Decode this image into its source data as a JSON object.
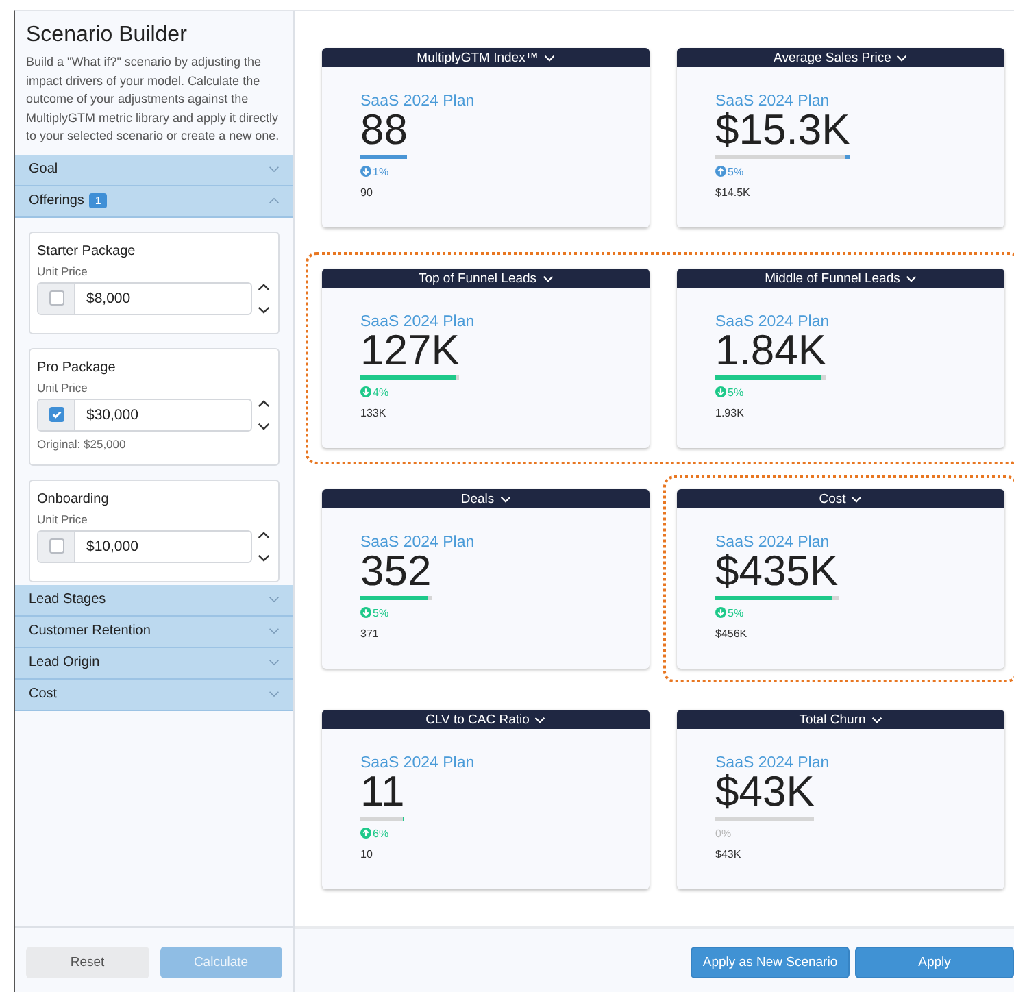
{
  "sidebar": {
    "title": "Scenario Builder",
    "description": "Build a \"What if?\" scenario by adjusting the impact drivers of your model. Calculate the outcome of your adjustments against the MultiplyGTM metric library and apply it directly to your selected scenario or create a new one.",
    "sections": [
      {
        "label": "Goal",
        "expanded": false
      },
      {
        "label": "Offerings",
        "expanded": true,
        "badge": "1",
        "items": [
          {
            "name": "Starter Package",
            "field_label": "Unit Price",
            "checked": false,
            "value": "$8,000"
          },
          {
            "name": "Pro Package",
            "field_label": "Unit Price",
            "checked": true,
            "value": "$30,000",
            "note": "Original: $25,000"
          },
          {
            "name": "Onboarding",
            "field_label": "Unit Price",
            "checked": false,
            "value": "$10,000"
          }
        ]
      },
      {
        "label": "Lead Stages",
        "expanded": false
      },
      {
        "label": "Customer Retention",
        "expanded": false
      },
      {
        "label": "Lead Origin",
        "expanded": false
      },
      {
        "label": "Cost",
        "expanded": false
      }
    ],
    "buttons": [
      {
        "label": "Reset",
        "kind": "secondary",
        "disabled": false
      },
      {
        "label": "Calculate",
        "kind": "primary",
        "disabled": true
      }
    ]
  },
  "metric_rows": [
    {
      "highlighted": false,
      "cards": [
        {
          "title": "MultiplyGTM Index™",
          "plan": "SaaS 2024 Plan",
          "value": "88",
          "level": 1,
          "kind": "down",
          "color": "#4a96d6",
          "delta": "1%",
          "baseline": "90",
          "highlighted": false
        },
        {
          "title": "Average Sales Price",
          "plan": "SaaS 2024 Plan",
          "value": "$15.3K",
          "level": 0.03,
          "kind": "up",
          "color": "#4a96d6",
          "delta": "5%",
          "baseline": "$14.5K",
          "highlighted": false
        }
      ]
    },
    {
      "highlighted": true,
      "cards": [
        {
          "title": "Top of Funnel Leads",
          "plan": "SaaS 2024 Plan",
          "value": "127K",
          "level": 0.97,
          "kind": "down",
          "color": "#1ec98a",
          "delta": "4%",
          "baseline": "133K",
          "highlighted": false
        },
        {
          "title": "Middle of Funnel Leads",
          "plan": "SaaS 2024 Plan",
          "value": "1.84K",
          "level": 0.95,
          "kind": "down",
          "color": "#1ec98a",
          "delta": "5%",
          "baseline": "1.93K",
          "highlighted": false
        }
      ]
    },
    {
      "highlighted": false,
      "cards": [
        {
          "title": "Deals",
          "plan": "SaaS 2024 Plan",
          "value": "352",
          "level": 0.95,
          "kind": "down",
          "color": "#1ec98a",
          "delta": "5%",
          "baseline": "371",
          "highlighted": false
        },
        {
          "title": "Cost",
          "plan": "SaaS 2024 Plan",
          "value": "$435K",
          "level": 0.95,
          "kind": "down",
          "color": "#1ec98a",
          "delta": "5%",
          "baseline": "$456K",
          "highlighted": true
        }
      ]
    },
    {
      "highlighted": false,
      "cards": [
        {
          "title": "CLV to CAC Ratio",
          "plan": "SaaS 2024 Plan",
          "value": "11",
          "level": 0.05,
          "kind": "up",
          "color": "#1ec98a",
          "delta": "6%",
          "baseline": "10",
          "highlighted": false
        },
        {
          "title": "Total Churn",
          "plan": "SaaS 2024 Plan",
          "value": "$43K",
          "level": 0,
          "kind": "flat",
          "color": "#b8b8b8",
          "delta": "0%",
          "baseline": "$43K",
          "highlighted": false
        }
      ]
    }
  ],
  "footer_buttons": [
    {
      "label": "Apply as New Scenario"
    },
    {
      "label": "Apply"
    }
  ]
}
